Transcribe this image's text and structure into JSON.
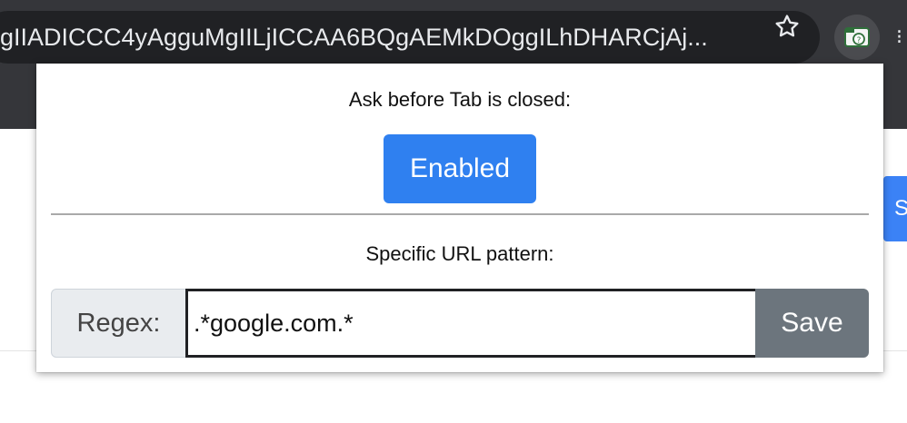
{
  "browser": {
    "url": "gIIADICCC4yAgguMgIILjICCAA6BQgAEMkDOggILhDHARCjAj...",
    "star_icon": "star-icon",
    "extension_icon": "tab-close-guard-icon",
    "menu_icon": "menu-icon"
  },
  "page": {
    "button_partial": "S"
  },
  "popup": {
    "title": "Ask before Tab is closed:",
    "toggle_label": "Enabled",
    "url_pattern_label": "Specific URL pattern:",
    "regex_prefix": "Regex:",
    "regex_value": ".*google.com.*",
    "save_label": "Save"
  },
  "colors": {
    "accent": "#2f80f0",
    "save": "#6c757d",
    "chrome_dark": "#35363a",
    "omnibox": "#202124"
  }
}
